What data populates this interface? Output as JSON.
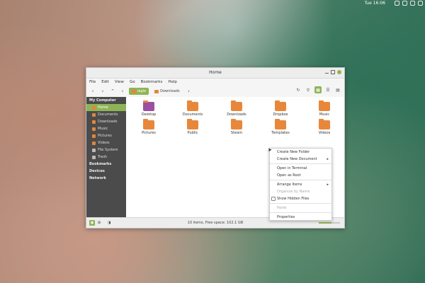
{
  "topbar": {
    "clock": "Tue 16:06",
    "tray_icons": [
      "network-icon",
      "volume-icon",
      "wifi-icon",
      "shield-icon"
    ]
  },
  "window": {
    "title": "Home",
    "menu": [
      "File",
      "Edit",
      "View",
      "Go",
      "Bookmarks",
      "Help"
    ],
    "breadcrumbs": [
      {
        "label": "lagie",
        "active": true
      },
      {
        "label": "Downloads",
        "active": false
      }
    ]
  },
  "sidebar": {
    "sections": [
      {
        "label": "My Computer",
        "items": [
          {
            "label": "Home",
            "active": true,
            "icon": "home-folder-icon"
          },
          {
            "label": "Documents",
            "active": false,
            "icon": "folder-icon"
          },
          {
            "label": "Downloads",
            "active": false,
            "icon": "folder-icon"
          },
          {
            "label": "Music",
            "active": false,
            "icon": "folder-icon"
          },
          {
            "label": "Pictures",
            "active": false,
            "icon": "folder-icon"
          },
          {
            "label": "Videos",
            "active": false,
            "icon": "folder-icon"
          },
          {
            "label": "File System",
            "active": false,
            "icon": "drive-icon"
          },
          {
            "label": "Trash",
            "active": false,
            "icon": "trash-icon"
          }
        ]
      },
      {
        "label": "Bookmarks",
        "items": []
      },
      {
        "label": "Devices",
        "items": []
      },
      {
        "label": "Network",
        "items": []
      }
    ]
  },
  "files": [
    {
      "label": "Desktop",
      "icon": "desktop-folder-icon",
      "color": "#9b4fa0"
    },
    {
      "label": "Documents",
      "icon": "documents-folder-icon",
      "color": "#e8873a"
    },
    {
      "label": "Downloads",
      "icon": "downloads-folder-icon",
      "color": "#e8873a"
    },
    {
      "label": "Dropbox",
      "icon": "dropbox-folder-icon",
      "color": "#e8873a"
    },
    {
      "label": "Music",
      "icon": "music-folder-icon",
      "color": "#e8873a"
    },
    {
      "label": "Pictures",
      "icon": "pictures-folder-icon",
      "color": "#e8873a"
    },
    {
      "label": "Public",
      "icon": "public-folder-icon",
      "color": "#e8873a"
    },
    {
      "label": "Steam",
      "icon": "steam-folder-icon",
      "color": "#e8873a"
    },
    {
      "label": "Templates",
      "icon": "templates-folder-icon",
      "color": "#e8873a"
    },
    {
      "label": "Videos",
      "icon": "videos-folder-icon",
      "color": "#e8873a"
    }
  ],
  "context_menu": [
    {
      "label": "Create New Folder",
      "disabled": false,
      "submenu": false
    },
    {
      "label": "Create New Document",
      "disabled": false,
      "submenu": true
    },
    {
      "sep": true
    },
    {
      "label": "Open in Terminal",
      "disabled": false,
      "submenu": false
    },
    {
      "label": "Open as Root",
      "disabled": false,
      "submenu": false
    },
    {
      "sep": true
    },
    {
      "label": "Arrange Items",
      "disabled": false,
      "submenu": true
    },
    {
      "label": "Organize by Name",
      "disabled": true,
      "submenu": false
    },
    {
      "label": "Show Hidden Files",
      "disabled": false,
      "submenu": false,
      "checkbox": true
    },
    {
      "sep": true
    },
    {
      "label": "Paste",
      "disabled": true,
      "submenu": false
    },
    {
      "sep": true
    },
    {
      "label": "Properties",
      "disabled": false,
      "submenu": false
    }
  ],
  "statusbar": {
    "text": "10 items, Free space: 102.1 GB",
    "zoom": 0.6
  },
  "colors": {
    "accent": "#8fb455",
    "folder": "#e8873a",
    "sidebar": "#4b4b4b"
  }
}
